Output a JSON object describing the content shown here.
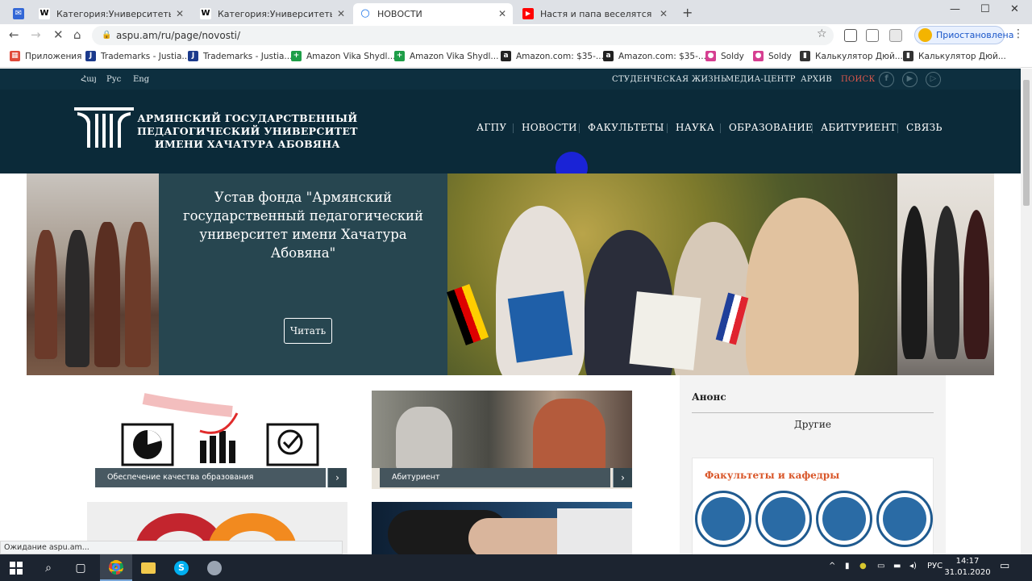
{
  "browser": {
    "tabs": [
      {
        "title": "Категория:Университеты Арм...",
        "fav": "W",
        "color": "#ffffff",
        "fg": "#000"
      },
      {
        "title": "Категория:Университеты Ереван...",
        "fav": "W",
        "color": "#ffffff",
        "fg": "#000"
      },
      {
        "title": "НОВОСТИ",
        "fav": "○",
        "color": "#ffffff",
        "fg": "#1a73e8"
      },
      {
        "title": "Настя и папа веселятся вместе...",
        "fav": "▶",
        "color": "#ff0000",
        "fg": "#fff"
      }
    ],
    "new_tab": "+",
    "window_controls": {
      "minimize": "—",
      "maximize": "☐",
      "close": "✕"
    },
    "url": "aspu.am/ru/page/novosti/",
    "profile_label": "Приостановлена",
    "status_text": "Ожидание aspu.am...",
    "bookmarks": [
      {
        "label": "Приложения",
        "ico": "▦",
        "color": "#e04a3a"
      },
      {
        "label": "Trademarks - Justia...",
        "ico": "J",
        "color": "#1b3a8c"
      },
      {
        "label": "Trademarks - Justia...",
        "ico": "J",
        "color": "#1b3a8c"
      },
      {
        "label": "Amazon Vika Shydl...",
        "ico": "+",
        "color": "#1e9e48"
      },
      {
        "label": "Amazon Vika Shydl...",
        "ico": "+",
        "color": "#1e9e48"
      },
      {
        "label": "Amazon.com: $35-...",
        "ico": "a",
        "color": "#222222"
      },
      {
        "label": "Amazon.com: $35-...",
        "ico": "a",
        "color": "#222222"
      },
      {
        "label": "Soldy",
        "ico": "●",
        "color": "#d63f91"
      },
      {
        "label": "Soldy",
        "ico": "●",
        "color": "#d63f91"
      },
      {
        "label": "Калькулятор Дюй...",
        "ico": "▮",
        "color": "#333333"
      },
      {
        "label": "Калькулятор Дюй...",
        "ico": "▮",
        "color": "#333333"
      }
    ]
  },
  "site": {
    "languages": [
      "Հայ",
      "Рус",
      "Eng"
    ],
    "top_links": [
      "СТУДЕНЧЕСКАЯ ЖИЗНЬ",
      "МЕДИА-ЦЕНТР",
      "АРХИВ",
      "ПОИСК"
    ],
    "social": [
      "f",
      "▶",
      "▷"
    ],
    "logo_lines": [
      "АРМЯНСКИЙ ГОСУДАРСТВЕННЫЙ",
      "ПЕДАГОГИЧЕСКИЙ УНИВЕРСИТЕТ",
      "ИМЕНИ ХАЧАТУРА АБОВЯНА"
    ],
    "nav": [
      "АГПУ",
      "НОВОСТИ",
      "ФАКУЛЬТЕТЫ",
      "НАУКА",
      "ОБРАЗОВАНИЕ",
      "АБИТУРИЕНТ",
      "СВЯЗЬ"
    ],
    "slide": {
      "title": "Устав фонда \"Армянский государственный педагогический университет имени Хачатура Абовяна\"",
      "button": "Читать"
    },
    "cards": [
      {
        "label": "Обеспечение качества образования"
      },
      {
        "label": "Абитуриент"
      }
    ],
    "sidebar": {
      "anons": "Анонс",
      "other": "Другие",
      "faculties": "Факультеты и кафедры"
    }
  },
  "taskbar": {
    "lang": "РУС",
    "time": "14:17",
    "date": "31.01.2020"
  }
}
